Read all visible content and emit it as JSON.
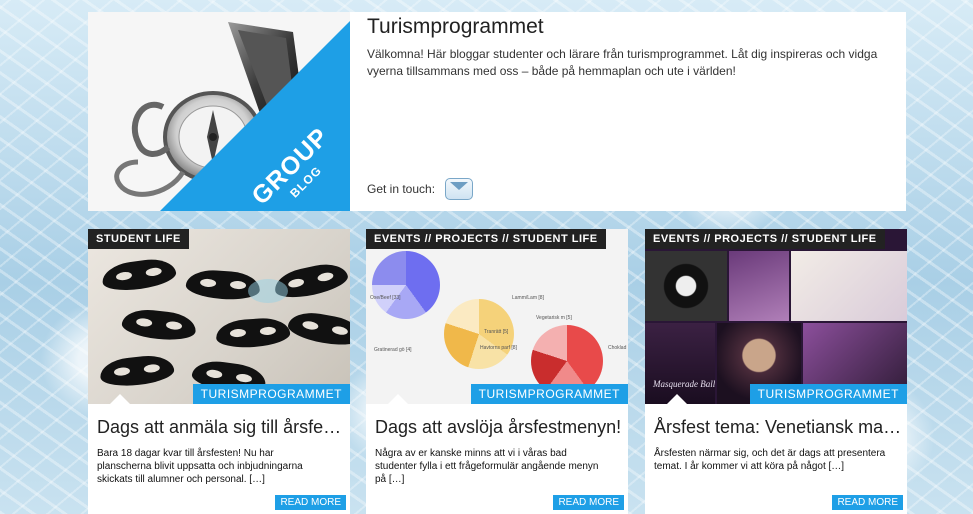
{
  "header": {
    "logo_line1": "GROUP",
    "logo_line2": "BLOG",
    "title": "Turismprogrammet",
    "description": "Välkomna! Här bloggar studenter och lärare från turismprogrammet. Låt dig inspireras och vidga vyerna tillsammans med oss – både på hemmaplan och ute i världen!",
    "get_in_touch": "Get in touch:"
  },
  "cards": [
    {
      "tag": "STUDENT LIFE",
      "category": "TURISMPROGRAMMET",
      "title": "Dags att anmäla sig till årsfesten!",
      "excerpt": "Bara 18 dagar kvar till årsfesten! Nu har planscherna blivit uppsatta och inbjudningarna skickats till alumner och personal. […]",
      "read_more": "READ MORE"
    },
    {
      "tag": "EVENTS // PROJECTS // STUDENT LIFE",
      "category": "TURISMPROGRAMMET",
      "title": "Dags att avslöja årsfestmenyn!",
      "excerpt": "Några av er kanske minns att vi i våras bad studenter fylla i ett frågeformulär angående menyn på […]",
      "read_more": "READ MORE",
      "image_labels": [
        "Oxe/Beef [33]",
        "Lamm/Lam [8]",
        "Vegetarisk m [5]",
        "Tranrätt [5]",
        "Havtorns parf [8]",
        "Gratinerad gö [4]",
        "Choklad"
      ]
    },
    {
      "tag": "EVENTS // PROJECTS // STUDENT LIFE",
      "category": "TURISMPROGRAMMET",
      "title": "Årsfest tema: Venetiansk mask…",
      "excerpt": "Årsfesten närmar sig, och det är dags att presentera temat. I år kommer vi att köra på något […]",
      "read_more": "READ MORE",
      "image_labels": [
        "Masquerade Ball"
      ]
    }
  ],
  "colors": {
    "accent": "#1e9fe6",
    "tag_bg": "#222222"
  }
}
